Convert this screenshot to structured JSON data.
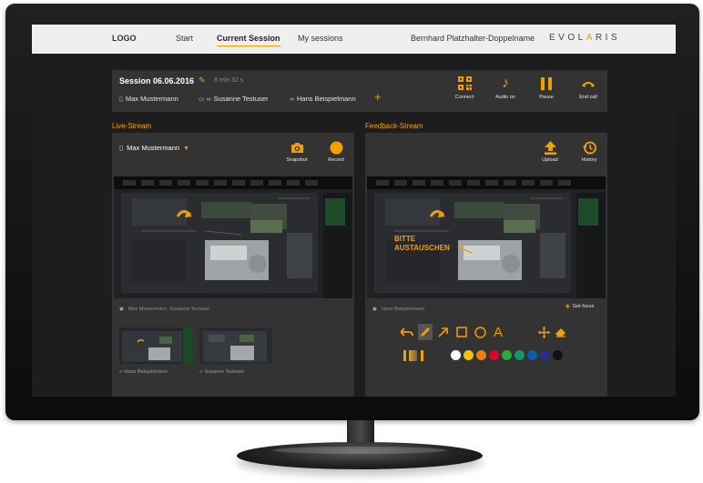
{
  "nav": {
    "logo": "LOGO",
    "start": "Start",
    "current_session": "Current Session",
    "my_sessions": "My sessions",
    "user": "Bernhard Platzhalter-Doppelname",
    "brand_left": "EVOL",
    "brand_accent": "A",
    "brand_right": "RIS"
  },
  "session": {
    "title": "Session 06.06.2016",
    "duration": "8 min 32 s",
    "participants": [
      {
        "name": "Max Mustermann",
        "device": "phone"
      },
      {
        "name": "Susanne Testuser",
        "device": "laptop+glasses"
      },
      {
        "name": "Hans Beispielmann",
        "device": "glasses"
      }
    ],
    "controls": [
      {
        "label": "Connect",
        "icon": "qr-code-icon"
      },
      {
        "label": "Audio on",
        "icon": "music-note-icon"
      },
      {
        "label": "Pause",
        "icon": "pause-icon"
      },
      {
        "label": "End call",
        "icon": "hang-up-icon"
      }
    ]
  },
  "live": {
    "heading": "Live-Stream",
    "camera": "Max Mustermann",
    "snapshot_label": "Snapshot",
    "record_label": "Record",
    "viewers": "Max Mustermann, Susanne Testuser",
    "thumbs": [
      {
        "label": "Hans Beispielmann"
      },
      {
        "label": "Susanne Testuser"
      }
    ]
  },
  "feedback": {
    "heading": "Feedback-Stream",
    "upload_label": "Upload",
    "history_label": "History",
    "viewers": "Hans Beispielmann",
    "get_focus": "Get focus",
    "annotation_line1": "BITTE",
    "annotation_line2": "AUSTAUSCHEN",
    "text_tool": "A",
    "palette": [
      "#ffffff",
      "#f5c400",
      "#f07d00",
      "#e4002b",
      "#2daa3c",
      "#0f9a66",
      "#0d5aa7",
      "#2c2e8c",
      "#111111"
    ]
  },
  "colors": {
    "accent": "#f0a000",
    "panel": "#333333",
    "screen": "#1d1d1d"
  }
}
